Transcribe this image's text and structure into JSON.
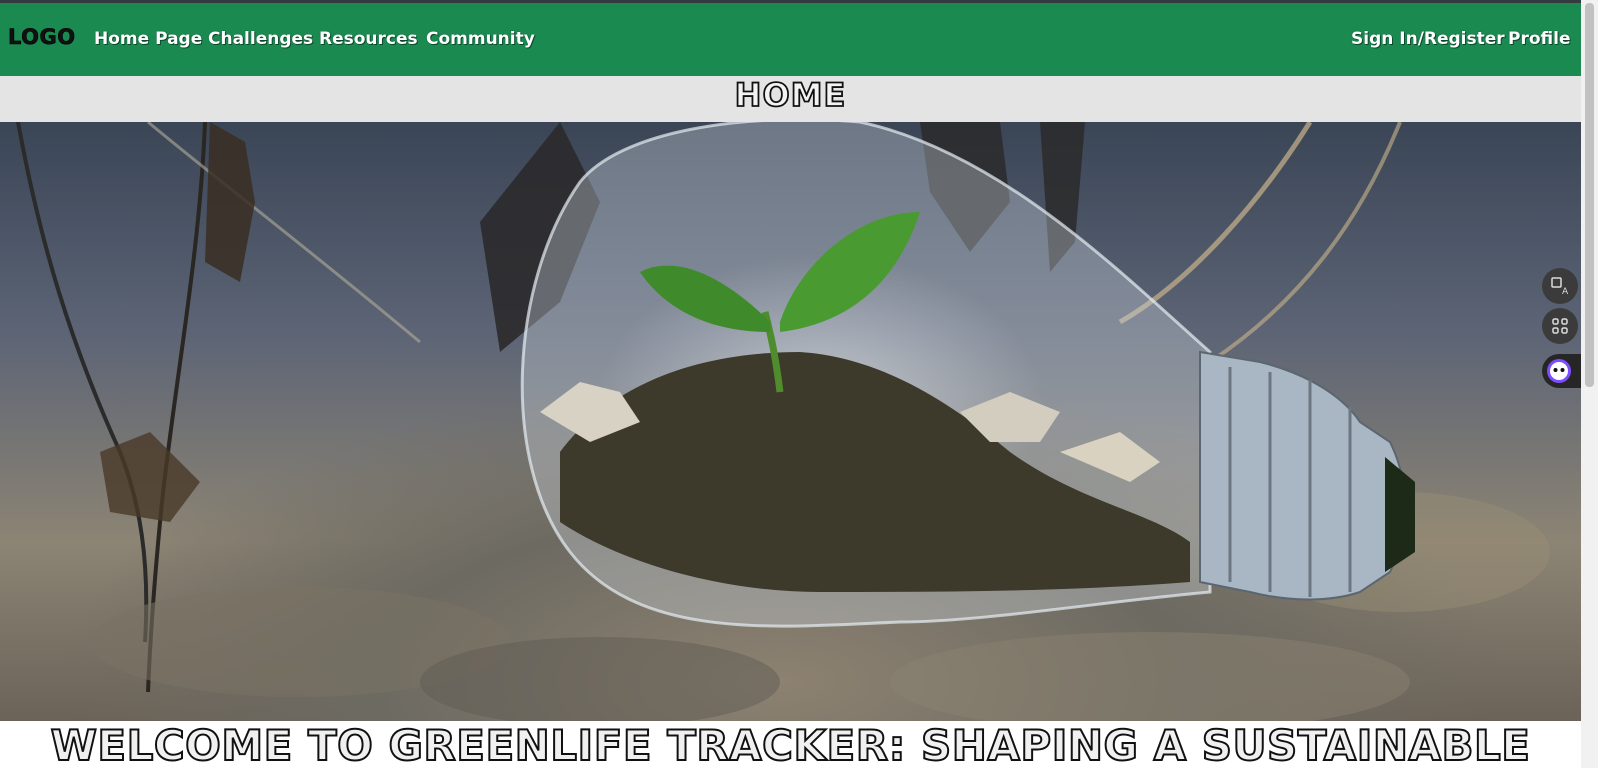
{
  "navbar": {
    "logo": "LOGO",
    "links": [
      "Home Page",
      "Challenges",
      "Resources",
      "Community"
    ],
    "right_links": [
      "Sign In/Register",
      "Profile"
    ],
    "background_color": "#1a8a51"
  },
  "page_title": "HOME",
  "hero": {
    "image_subject": "seedling-in-lightbulb"
  },
  "side_tools": [
    {
      "name": "translate-icon"
    },
    {
      "name": "apps-grid-icon"
    },
    {
      "name": "assistant-face-icon"
    }
  ],
  "welcome": {
    "heading": "WELCOME TO GREENLIFE TRACKER: SHAPING A SUSTAINABLE"
  }
}
